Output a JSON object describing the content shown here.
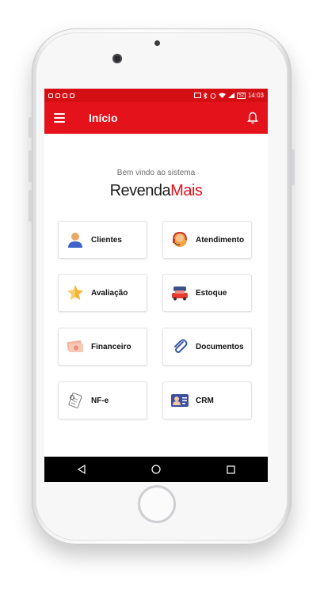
{
  "status_bar": {
    "time": "14:03",
    "battery": "52"
  },
  "app_bar": {
    "title": "Início"
  },
  "welcome": {
    "text": "Bem vindo ao sistema",
    "brand_part1": "Revenda",
    "brand_part2": "Mais"
  },
  "menu": [
    {
      "label": "Clientes",
      "icon": "user-icon"
    },
    {
      "label": "Atendimento",
      "icon": "support-agent-icon"
    },
    {
      "label": "Avaliação",
      "icon": "star-icon"
    },
    {
      "label": "Estoque",
      "icon": "cars-icon"
    },
    {
      "label": "Financeiro",
      "icon": "money-icon"
    },
    {
      "label": "Documentos",
      "icon": "paperclip-icon"
    },
    {
      "label": "NF-e",
      "icon": "invoice-icon"
    },
    {
      "label": "CRM",
      "icon": "contact-card-icon"
    }
  ],
  "colors": {
    "brand_red": "#e3121b",
    "status_red": "#d40f14"
  }
}
